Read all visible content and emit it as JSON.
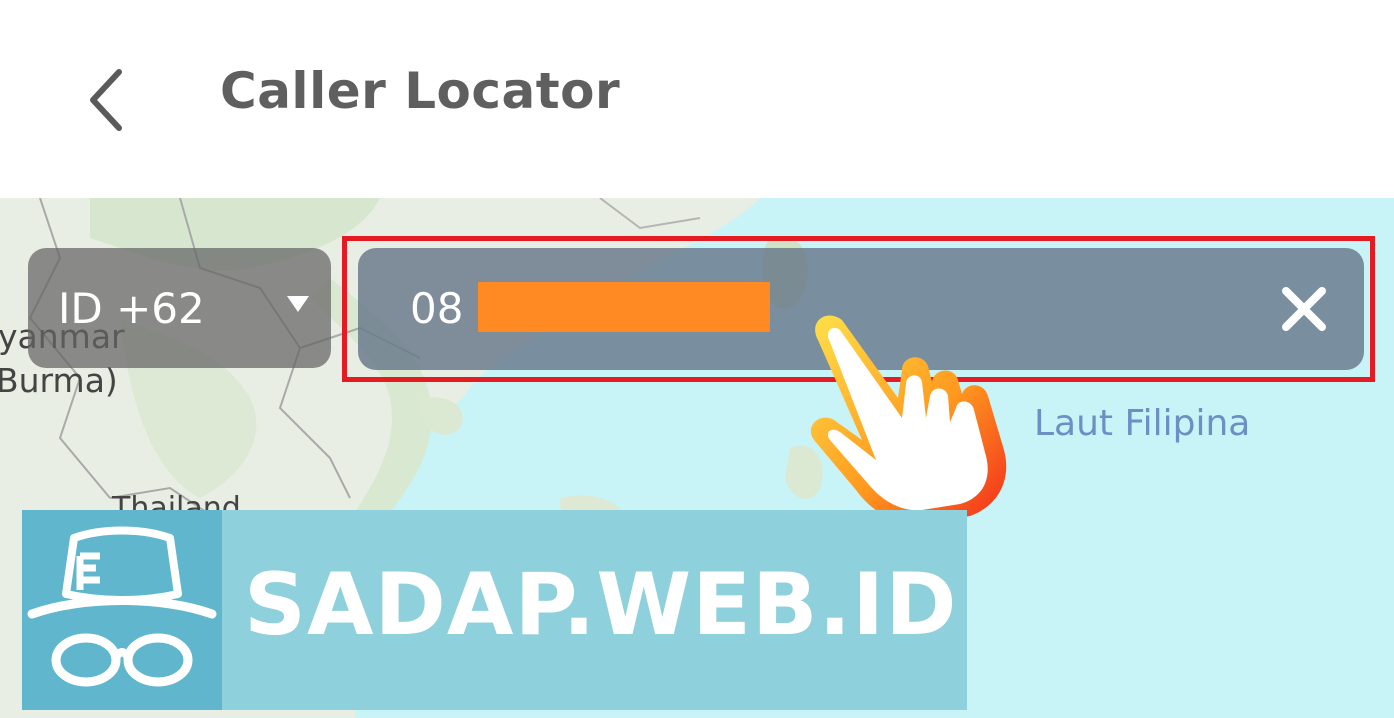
{
  "header": {
    "title": "Caller Locator",
    "back_icon": "chevron-left-icon"
  },
  "map": {
    "labels": {
      "myanmar_line1": "yanmar",
      "myanmar_line2": "Burma)",
      "thailand": "Thailand",
      "sea": "Laut Filipina"
    }
  },
  "search": {
    "country_code": "ID +62",
    "phone_prefix": "08",
    "phone_redacted": true,
    "clear_icon": "close-icon",
    "dropdown_icon": "triangle-down-icon"
  },
  "overlay": {
    "pointer_icon": "hand-pointer-icon",
    "highlight_color": "#e41b22",
    "redaction_color": "#ff8a23"
  },
  "watermark": {
    "text": "SADAP.WEB.ID",
    "logo_icon": "spy-hat-glasses-icon"
  }
}
